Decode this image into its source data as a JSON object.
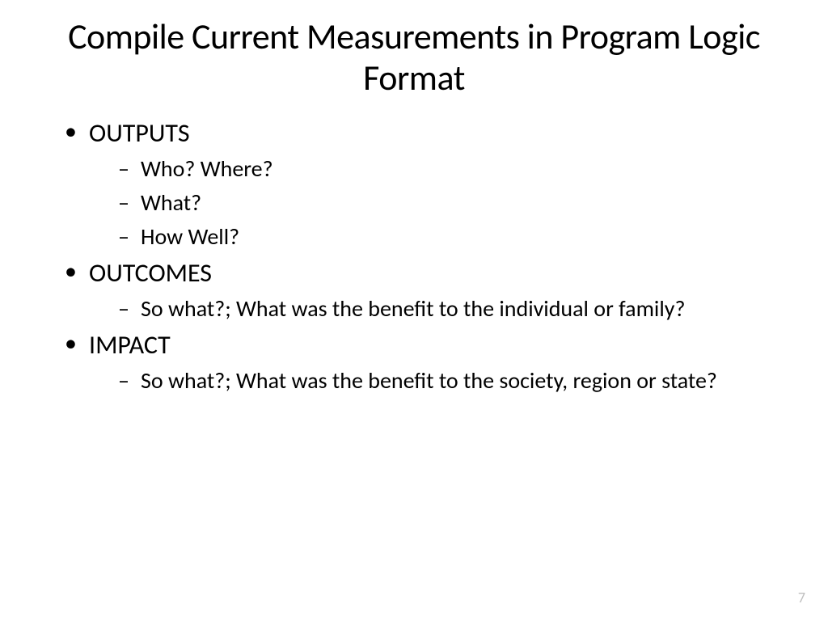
{
  "slide": {
    "title": "Compile Current Measurements in Program Logic Format",
    "bullets": [
      {
        "label": "OUTPUTS",
        "sub": [
          "Who? Where?",
          "What?",
          "How Well?"
        ]
      },
      {
        "label": " OUTCOMES",
        "sub": [
          "So what?; What was the benefit to the individual or family?"
        ]
      },
      {
        "label": "IMPACT",
        "sub": [
          "So what?; What was the benefit to the society, region or state?"
        ]
      }
    ],
    "pageNumber": "7"
  }
}
